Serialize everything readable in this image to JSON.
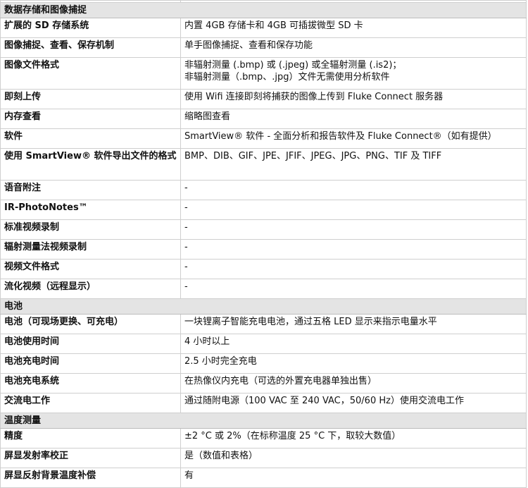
{
  "sections": [
    {
      "title": "数据存储和图像捕捉",
      "rows": [
        {
          "label": "扩展的 SD 存储系统",
          "value": "内置 4GB 存储卡和 4GB 可插拔微型 SD 卡"
        },
        {
          "label": "图像捕捉、查看、保存机制",
          "value": "单手图像捕捉、查看和保存功能"
        },
        {
          "label": "图像文件格式",
          "value": "非辐射测量 (.bmp) 或 (.jpeg) 或全辐射测量 (.is2)；",
          "value2": "非辐射测量（.bmp、.jpg）文件无需使用分析软件"
        },
        {
          "label": "即刻上传",
          "value": "使用 Wifi 连接即刻将捕获的图像上传到 Fluke Connect 服务器"
        },
        {
          "label": "内存查看",
          "value": "缩略图查看"
        },
        {
          "label": "软件",
          "value": "SmartView® 软件 - 全面分析和报告软件及 Fluke Connect®（如有提供）"
        },
        {
          "label": "使用 SmartView® 软件导出文件的格式",
          "value": "BMP、DIB、GIF、JPE、JFIF、JPEG、JPG、PNG、TIF 及 TIFF"
        },
        {
          "label": "语音附注",
          "value": "-"
        },
        {
          "label": "IR-PhotoNotes™",
          "value": "-"
        },
        {
          "label": "标准视频录制",
          "value": "-"
        },
        {
          "label": "辐射测量法视频录制",
          "value": "-"
        },
        {
          "label": "视频文件格式",
          "value": "-"
        },
        {
          "label": "流化视频（远程显示）",
          "value": "-"
        }
      ]
    },
    {
      "title": "电池",
      "rows": [
        {
          "label": "电池（可现场更换、可充电）",
          "value": "一块锂离子智能充电电池，通过五格 LED 显示来指示电量水平"
        },
        {
          "label": "电池使用时间",
          "value": "4 小时以上"
        },
        {
          "label": "电池充电时间",
          "value": "2.5 小时完全充电"
        },
        {
          "label": "电池充电系统",
          "value": "在热像仪内充电（可选的外置充电器单独出售）"
        },
        {
          "label": "交流电工作",
          "value": "通过随附电源（100 VAC 至 240 VAC，50/60 Hz）使用交流电工作"
        }
      ]
    },
    {
      "title": "温度测量",
      "rows": [
        {
          "label": "精度",
          "value": "±2 °C 或 2%（在标称温度 25 °C 下，取较大数值）"
        },
        {
          "label": "屏显发射率校正",
          "value": "是（数值和表格）"
        },
        {
          "label": "屏显反射背景温度补偿",
          "value": "有"
        }
      ]
    }
  ]
}
